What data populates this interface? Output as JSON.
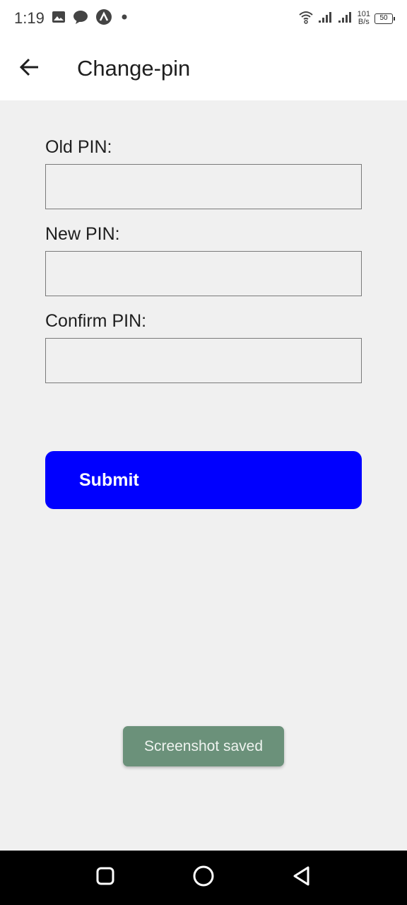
{
  "status_bar": {
    "time": "1:19",
    "net_speed_value": "101",
    "net_speed_unit": "B/s",
    "battery": "50",
    "icons": [
      "image-icon",
      "chat-bubble-icon",
      "app-a-icon",
      "dot-icon",
      "wifi-icon",
      "signal-icon",
      "signal-icon",
      "battery-icon"
    ]
  },
  "app_bar": {
    "title": "Change-pin",
    "back_icon": "arrow-left-icon"
  },
  "form": {
    "old_pin_label": "Old PIN:",
    "old_pin_value": "",
    "new_pin_label": "New PIN:",
    "new_pin_value": "",
    "confirm_pin_label": "Confirm PIN:",
    "confirm_pin_value": "",
    "submit_label": "Submit"
  },
  "toast": {
    "message": "Screenshot saved"
  },
  "nav_bar": {
    "icons": [
      "recents-square-icon",
      "home-circle-icon",
      "back-triangle-icon"
    ]
  },
  "colors": {
    "background": "#f0f0f0",
    "submit_button": "#0000ff",
    "toast_background": "#6b917a",
    "nav_bar": "#000000"
  }
}
